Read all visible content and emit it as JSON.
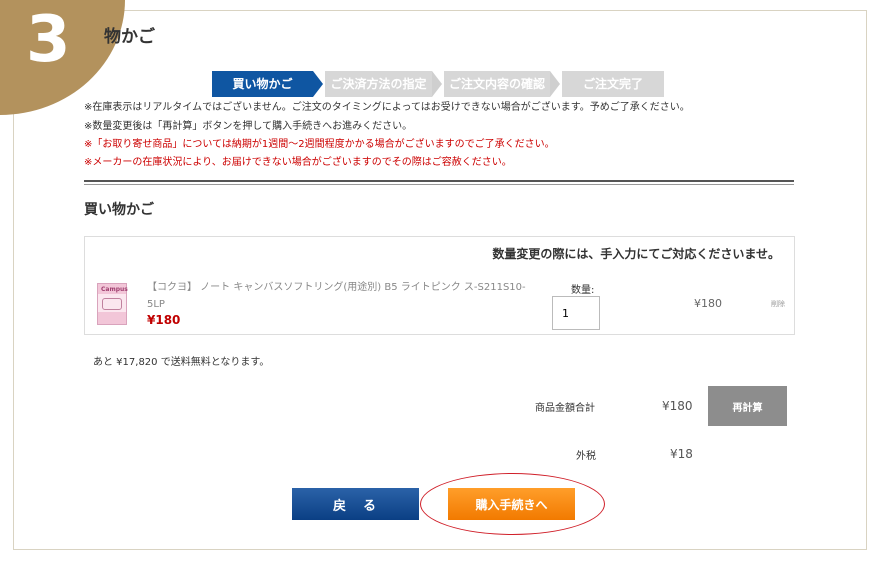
{
  "step_number": "3",
  "page_title": "物かご",
  "steps": [
    {
      "label": "買い物かご",
      "active": true
    },
    {
      "label": "ご決済方法の指定",
      "active": false
    },
    {
      "label": "ご注文内容の確認",
      "active": false
    },
    {
      "label": "ご注文完了",
      "active": false
    }
  ],
  "notices": [
    {
      "text": "※在庫表示はリアルタイムではございません。ご注文のタイミングによってはお受けできない場合がございます。予めご了承ください。",
      "color": "#333333"
    },
    {
      "text": "※数量変更後は「再計算」ボタンを押して購入手続きへお進みください。",
      "color": "#333333"
    },
    {
      "text": "※「お取り寄せ商品」については納期が1週間～2週間程度かかる場合がございますのでご了承ください。",
      "color": "#cc0000"
    },
    {
      "text": "※メーカーの在庫状況により、お届けできない場合がございますのでその際はご容赦ください。",
      "color": "#cc0000"
    }
  ],
  "cart": {
    "section_title": "買い物かご",
    "qty_note": "数量変更の際には、手入力にてご対応くださいませ。",
    "item": {
      "thumbnail_text": "Campus",
      "name": "【コクヨ】 ノート キャンバスソフトリング(用途別) B5 ライトピンク ス-S211S10-5LP",
      "unit_price": "¥180",
      "qty_label": "数量:",
      "qty_value": "1",
      "line_price": "¥180",
      "delete_label": "削除"
    }
  },
  "free_shipping_note": "あと ¥17,820 で送料無料となります。",
  "summary": {
    "subtotal_label": "商品金額合計",
    "subtotal_value": "¥180",
    "recalc_label": "再計算",
    "tax_label": "外税",
    "tax_value": "¥18"
  },
  "buttons": {
    "back_label": "戻　る",
    "checkout_label": "購入手続きへ"
  },
  "colors": {
    "accent_gold": "#b3925d",
    "step_active": "#0f56a2",
    "price_red": "#c00000",
    "checkout_orange": "#f27a00",
    "back_blue": "#0b3f84",
    "highlight_ring": "#d0202a"
  }
}
